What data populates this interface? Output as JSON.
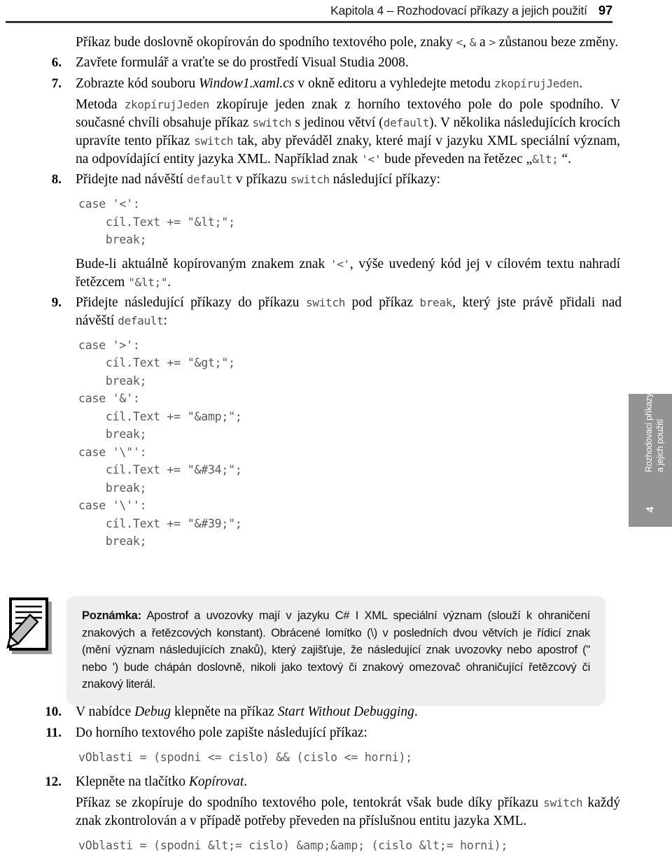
{
  "header": {
    "title": "Kapitola 4 – Rozhodovací příkazy a jejich použití",
    "page_number": "97"
  },
  "side_tab": {
    "line1": "Rozhodovací příkazy",
    "line2": "a jejich použití",
    "chapter_number": "4",
    "bg_color": "#939393",
    "text_color": "#ffffff"
  },
  "content": {
    "intro": {
      "p1_a": "Příkaz bude doslovně okopírován do spodního textového pole, znaky ",
      "p1_lt": "<",
      "p1_b": ", ",
      "p1_amp": "&",
      "p1_c": " a ",
      "p1_gt": ">",
      "p1_d": " zůstanou beze změny."
    },
    "items": [
      {
        "num": "6.",
        "text": "Zavřete formulář a vraťte se do prostředí Visual Studia 2008."
      },
      {
        "num": "7.",
        "text_a": "Zobrazte kód souboru ",
        "italic": "Window1.xaml.cs",
        "text_b": " v okně editoru a vyhledejte metodu ",
        "mono": "zkopírujJeden",
        "text_c": "."
      },
      {
        "num": "8.",
        "text_a": "Přidejte nad návěští ",
        "mono1": "default",
        "text_b": " v příkazu ",
        "mono2": "switch",
        "text_c": " následující příkazy:"
      },
      {
        "num": "9.",
        "text_a": "Přidejte následující příkazy do příkazu ",
        "mono1": "switch",
        "text_b": " pod příkaz ",
        "mono2": "break",
        "text_c": ", který jste právě přidali nad návěští ",
        "mono3": "default",
        "text_d": ":"
      },
      {
        "num": "10.",
        "text_a": "V nabídce ",
        "italic1": "Debug",
        "text_b": " klepněte na příkaz ",
        "italic2": "Start Without Debugging",
        "text_c": "."
      },
      {
        "num": "11.",
        "text": "Do horního textového pole zapište následující příkaz:"
      },
      {
        "num": "12.",
        "text_a": "Klepněte na tlačítko ",
        "italic": "Kopírovat",
        "text_b": "."
      }
    ],
    "paragraph_method": {
      "a": "Metoda ",
      "mono1": "zkopírujJeden",
      "b": " zkopíruje jeden znak z horního textového pole do pole spodního. V současné chvíli obsahuje příkaz ",
      "mono2": "switch",
      "c": " s jedinou větví (",
      "mono3": "default",
      "d": "). V několika následujících krocích upravíte tento příkaz ",
      "mono4": "switch",
      "e": " tak, aby převáděl znaky, které mají v jazyku XML speciální význam, na odpovídající entity jazyka XML. Například znak ",
      "mono5": "'<'",
      "f": " bude převeden na řetězec „",
      "mono6": "&lt;",
      "g": " “."
    },
    "code_1": "case '<':\n    cíl.Text += \"&lt;\";\n    break;",
    "paragraph_budeli": {
      "a": "Bude-li aktuálně kopírovaným znakem znak ",
      "mono1": "'<'",
      "b": ", výše uvedený kód jej v cílovém textu nahradí řetězcem ",
      "mono2": "\"&lt;\"",
      "c": "."
    },
    "code_2": "case '>':\n    cíl.Text += \"&gt;\";\n    break;\ncase '&':\n    cíl.Text += \"&amp;\";\n    break;\ncase '\\\"':\n    cíl.Text += \"&#34;\";\n    break;\ncase '\\'':\n    cíl.Text += \"&#39;\";\n    break;",
    "code_3": "vOblasti = (spodni <= cislo) && (cislo <= horni);",
    "paragraph_final": {
      "a": "Příkaz se zkopíruje do spodního textového pole, tentokrát však bude díky příkazu ",
      "mono1": "switch",
      "b": " každý znak zkontrolován a v případě potřeby převeden na příslušnou entitu jazyka XML."
    },
    "code_4": "vOblasti = (spodni &lt;= cislo) &amp;&amp; (cislo &lt;= horni);"
  },
  "note": {
    "label": "Poznámka:",
    "body": " Apostrof a uvozovky mají v jazyku C# I XML speciální význam (slouží k ohraničení znakových a řetězcových konstant). Obrácené lomítko (\\) v posledních dvou větvích je řídicí znak (mění význam následujících znaků), který zajišťuje, že následující znak uvozovky nebo apostrof (\" nebo ') bude chápán doslovně, nikoli jako textový či znakový omezovač ohraničující řetězcový či znakový literál.",
    "icon": "note-pencil-icon",
    "bg_color": "#eeeeee"
  }
}
